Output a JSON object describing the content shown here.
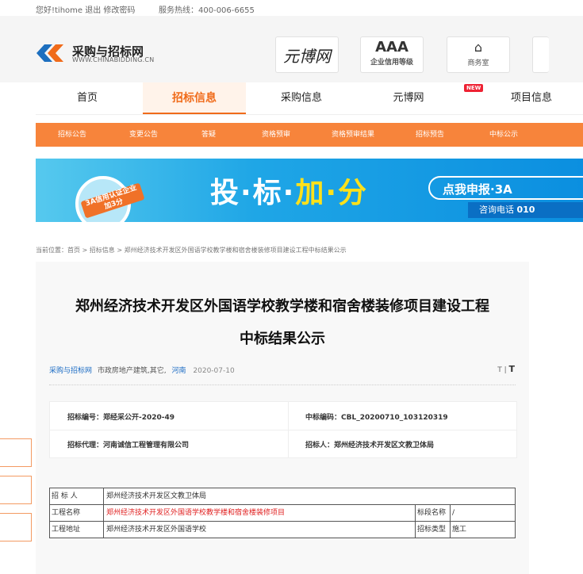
{
  "topbar": {
    "greeting": "您好!tihome 退出 修改密码",
    "hotline": "服务热线：400-006-6655"
  },
  "logo": {
    "name": "采购与招标网",
    "url": "WWW.CHINABIDDING.CN"
  },
  "badges": {
    "yuanbo": "元博网",
    "aaa_big": "AAA",
    "aaa_small": "企业信用等级",
    "office": "商务室"
  },
  "nav": {
    "items": [
      "首页",
      "招标信息",
      "采购信息",
      "元博网",
      "项目信息"
    ],
    "active_index": 1,
    "new_tag": "NEW"
  },
  "subnav": {
    "items": [
      "招标公告",
      "变更公告",
      "答疑",
      "资格预审",
      "资格预审结果",
      "招标预告",
      "中标公示"
    ]
  },
  "banner": {
    "stamp_text": "3A信用认证企业 加3分",
    "headline_a": "投·标·",
    "headline_b": "加·分",
    "cta": "点我申报·3A",
    "phone_label": "咨询电话",
    "phone_number": "010"
  },
  "breadcrumb": "当前位置：首页 > 招标信息 > 郑州经济技术开发区外国语学校教学楼和宿舍楼装修项目建设工程中标结果公示",
  "article": {
    "title_line1": "郑州经济技术开发区外国语学校教学楼和宿舍楼装修项目建设工程",
    "title_line2": "中标结果公示",
    "source": "采购与招标网",
    "category": "市政房地产建筑,其它,",
    "location": "河南",
    "date": "2020-07-10",
    "font_small": "T",
    "font_sep": "|",
    "font_big": "T"
  },
  "info": {
    "bid_no": "招标编号：郑经采公开-2020-49",
    "award_no": "中标编码：CBL_20200710_103120319",
    "agent": "招标代理：河南诚信工程管理有限公司",
    "tenderer": "招标人：郑州经济技术开发区文教卫体局"
  },
  "table": {
    "rows": [
      {
        "label": "招 标 人",
        "value": "郑州经济技术开发区文教卫体局",
        "label2": "",
        "value2": ""
      },
      {
        "label": "工程名称",
        "value": "郑州经济技术开发区外国语学校教学楼和宿舍楼装修项目",
        "label2": "标段名称",
        "value2": "/"
      },
      {
        "label": "工程地址",
        "value": "郑州经济技术开发区外国语学校",
        "label2": "招标类型",
        "value2": "施工"
      }
    ]
  },
  "colors": {
    "accent": "#f06b1a",
    "subnav_bg": "#f7843b",
    "link": "#1c6cc4",
    "highlight_red": "#e02020"
  }
}
